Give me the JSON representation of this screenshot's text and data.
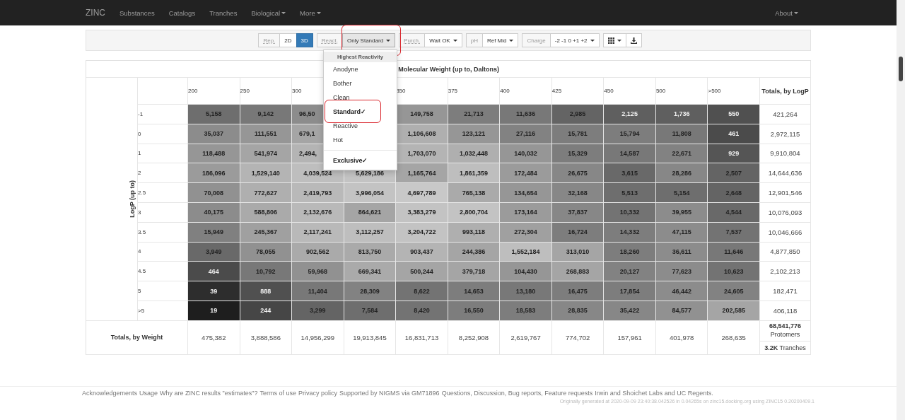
{
  "navbar": {
    "brand": "ZINC",
    "items": [
      {
        "label": "Substances",
        "dropdown": false
      },
      {
        "label": "Catalogs",
        "dropdown": false
      },
      {
        "label": "Tranches",
        "dropdown": false
      },
      {
        "label": "Biological",
        "dropdown": true
      },
      {
        "label": "More",
        "dropdown": true
      }
    ],
    "right_items": [
      {
        "label": "About",
        "dropdown": true
      }
    ]
  },
  "toolbar": {
    "groups": [
      {
        "items": [
          {
            "kind": "hint",
            "text": "Rep."
          },
          {
            "kind": "toggle",
            "text": "2D",
            "selected": false
          },
          {
            "kind": "toggle",
            "text": "3D",
            "selected": true
          }
        ]
      },
      {
        "items": [
          {
            "kind": "hint",
            "text": "React."
          },
          {
            "kind": "dropdown",
            "text": "Only Standard",
            "open": true,
            "highlighted": true,
            "menu": {
              "header": "Highest Reactivity",
              "items": [
                {
                  "label": "Anodyne",
                  "selected": false,
                  "highlighted": false
                },
                {
                  "label": "Bother",
                  "selected": false,
                  "highlighted": false
                },
                {
                  "label": "Clean",
                  "selected": false,
                  "highlighted": false
                },
                {
                  "label": "Standard✓",
                  "selected": true,
                  "highlighted": true
                },
                {
                  "label": "Reactive",
                  "selected": false,
                  "highlighted": false
                },
                {
                  "label": "Hot",
                  "selected": false,
                  "highlighted": false
                }
              ],
              "extra_items": [
                {
                  "label": "Exclusive✓",
                  "selected": true,
                  "highlighted": false
                }
              ]
            }
          }
        ]
      },
      {
        "items": [
          {
            "kind": "hint",
            "text": "Purch."
          },
          {
            "kind": "dropdown",
            "text": "Wait OK",
            "open": false,
            "highlighted": false
          }
        ]
      },
      {
        "items": [
          {
            "kind": "label",
            "text": "pH"
          },
          {
            "kind": "dropdown",
            "text": "Ref Mid",
            "open": false,
            "highlighted": false
          }
        ]
      },
      {
        "items": [
          {
            "kind": "label",
            "text": "Charge"
          },
          {
            "kind": "dropdown",
            "text": "-2 -1 0 +1 +2",
            "open": false,
            "highlighted": false
          }
        ]
      },
      {
        "items": [
          {
            "kind": "grid-menu"
          },
          {
            "kind": "download"
          }
        ]
      }
    ]
  },
  "table": {
    "title": "Molecular Weight (up to, Daltons)",
    "row_axis_label": "LogP (up to)",
    "columns": [
      "200",
      "250",
      "300",
      null,
      "350",
      "375",
      "400",
      "425",
      "450",
      "500",
      ">500"
    ],
    "totals_column_header": "Totals, by LogP",
    "rows": [
      {
        "logp": "-1",
        "cells": [
          {
            "value": "5,158",
            "color": "#6e6e6e"
          },
          {
            "value": "9,142",
            "color": "#787878"
          },
          {
            "value": "96,50",
            "color": "#8c8c8c"
          },
          null,
          {
            "value": "149,758",
            "color": "#969696"
          },
          {
            "value": "21,713",
            "color": "#7d7d7d"
          },
          {
            "value": "11,636",
            "color": "#787878"
          },
          {
            "value": "2,985",
            "color": "#646464"
          },
          {
            "value": "2,125",
            "color": "#5f5f5f"
          },
          {
            "value": "1,736",
            "color": "#5f5f5f"
          },
          {
            "value": "550",
            "color": "#505050"
          }
        ],
        "total": "421,264"
      },
      {
        "logp": "0",
        "cells": [
          {
            "value": "35,037",
            "color": "#8c8c8c"
          },
          {
            "value": "111,551",
            "color": "#969696"
          },
          {
            "value": "679,1",
            "color": "#a5a5a5"
          },
          null,
          {
            "value": "1,106,608",
            "color": "#afafaf"
          },
          {
            "value": "123,121",
            "color": "#969696"
          },
          {
            "value": "27,116",
            "color": "#828282"
          },
          {
            "value": "15,781",
            "color": "#7d7d7d"
          },
          {
            "value": "15,794",
            "color": "#7d7d7d"
          },
          {
            "value": "11,808",
            "color": "#787878"
          },
          {
            "value": "461",
            "color": "#4b4b4b"
          }
        ],
        "total": "2,972,115"
      },
      {
        "logp": "1",
        "cells": [
          {
            "value": "118,488",
            "color": "#969696"
          },
          {
            "value": "541,974",
            "color": "#a5a5a5"
          },
          {
            "value": "2,494,",
            "color": "#b4b4b4"
          },
          null,
          {
            "value": "1,703,070",
            "color": "#b4b4b4"
          },
          {
            "value": "1,032,448",
            "color": "#afafaf"
          },
          {
            "value": "140,032",
            "color": "#969696"
          },
          {
            "value": "15,329",
            "color": "#7d7d7d"
          },
          {
            "value": "14,587",
            "color": "#787878"
          },
          {
            "value": "22,671",
            "color": "#828282"
          },
          {
            "value": "929",
            "color": "#555555"
          }
        ],
        "total": "9,910,804"
      },
      {
        "logp": "2",
        "cells": [
          {
            "value": "186,096",
            "color": "#9b9b9b"
          },
          {
            "value": "1,529,140",
            "color": "#b4b4b4"
          },
          {
            "value": "4,039,524",
            "color": "#bebebe"
          },
          {
            "value": "5,629,186",
            "color": "#c3c3c3"
          },
          {
            "value": "1,165,764",
            "color": "#a5a5a5"
          },
          {
            "value": "1,861,359",
            "color": "#bebebe"
          },
          {
            "value": "172,484",
            "color": "#9b9b9b"
          },
          {
            "value": "26,675",
            "color": "#878787"
          },
          {
            "value": "3,615",
            "color": "#696969"
          },
          {
            "value": "28,286",
            "color": "#878787"
          },
          {
            "value": "2,507",
            "color": "#646464"
          }
        ],
        "total": "14,644,636"
      },
      {
        "logp": "2.5",
        "cells": [
          {
            "value": "70,008",
            "color": "#919191"
          },
          {
            "value": "772,627",
            "color": "#afafaf"
          },
          {
            "value": "2,419,793",
            "color": "#b9b9b9"
          },
          {
            "value": "3,996,054",
            "color": "#c3c3c3"
          },
          {
            "value": "4,697,789",
            "color": "#c8c8c8"
          },
          {
            "value": "765,138",
            "color": "#aaaaaa"
          },
          {
            "value": "134,654",
            "color": "#969696"
          },
          {
            "value": "32,168",
            "color": "#878787"
          },
          {
            "value": "5,513",
            "color": "#6e6e6e"
          },
          {
            "value": "5,154",
            "color": "#6e6e6e"
          },
          {
            "value": "2,648",
            "color": "#646464"
          }
        ],
        "total": "12,901,546"
      },
      {
        "logp": "3",
        "cells": [
          {
            "value": "40,175",
            "color": "#8c8c8c"
          },
          {
            "value": "588,806",
            "color": "#aaaaaa"
          },
          {
            "value": "2,132,676",
            "color": "#b9b9b9"
          },
          {
            "value": "864,621",
            "color": "#a5a5a5"
          },
          {
            "value": "3,383,279",
            "color": "#c3c3c3"
          },
          {
            "value": "2,800,704",
            "color": "#c3c3c3"
          },
          {
            "value": "173,164",
            "color": "#9b9b9b"
          },
          {
            "value": "37,837",
            "color": "#878787"
          },
          {
            "value": "10,332",
            "color": "#737373"
          },
          {
            "value": "39,955",
            "color": "#8c8c8c"
          },
          {
            "value": "4,544",
            "color": "#696969"
          }
        ],
        "total": "10,076,093"
      },
      {
        "logp": "3.5",
        "cells": [
          {
            "value": "15,949",
            "color": "#808080"
          },
          {
            "value": "245,367",
            "color": "#a0a0a0"
          },
          {
            "value": "2,117,241",
            "color": "#b9b9b9"
          },
          {
            "value": "3,112,257",
            "color": "#bebebe"
          },
          {
            "value": "3,204,722",
            "color": "#c3c3c3"
          },
          {
            "value": "993,118",
            "color": "#afafaf"
          },
          {
            "value": "272,304",
            "color": "#a0a0a0"
          },
          {
            "value": "16,724",
            "color": "#7d7d7d"
          },
          {
            "value": "14,332",
            "color": "#7d7d7d"
          },
          {
            "value": "47,115",
            "color": "#8c8c8c"
          },
          {
            "value": "7,537",
            "color": "#737373"
          }
        ],
        "total": "10,046,666"
      },
      {
        "logp": "4",
        "cells": [
          {
            "value": "3,949",
            "color": "#696969"
          },
          {
            "value": "78,055",
            "color": "#919191"
          },
          {
            "value": "902,562",
            "color": "#aaaaaa"
          },
          {
            "value": "813,750",
            "color": "#aaaaaa"
          },
          {
            "value": "903,437",
            "color": "#b4b4b4"
          },
          {
            "value": "244,386",
            "color": "#a5a5a5"
          },
          {
            "value": "1,552,184",
            "color": "#bebebe"
          },
          {
            "value": "313,010",
            "color": "#a5a5a5"
          },
          {
            "value": "18,260",
            "color": "#7d7d7d"
          },
          {
            "value": "36,611",
            "color": "#8c8c8c"
          },
          {
            "value": "11,646",
            "color": "#787878"
          }
        ],
        "total": "4,877,850"
      },
      {
        "logp": "4.5",
        "cells": [
          {
            "value": "464",
            "color": "#4b4b4b"
          },
          {
            "value": "10,792",
            "color": "#787878"
          },
          {
            "value": "59,968",
            "color": "#919191"
          },
          {
            "value": "669,341",
            "color": "#aaaaaa"
          },
          {
            "value": "500,244",
            "color": "#a5a5a5"
          },
          {
            "value": "379,718",
            "color": "#a5a5a5"
          },
          {
            "value": "104,430",
            "color": "#969696"
          },
          {
            "value": "268,883",
            "color": "#a5a5a5"
          },
          {
            "value": "20,127",
            "color": "#828282"
          },
          {
            "value": "77,623",
            "color": "#8c8c8c"
          },
          {
            "value": "10,623",
            "color": "#737373"
          }
        ],
        "total": "2,102,213"
      },
      {
        "logp": "5",
        "cells": [
          {
            "value": "39",
            "color": "#2d2d2d"
          },
          {
            "value": "888",
            "color": "#505050"
          },
          {
            "value": "11,404",
            "color": "#787878"
          },
          {
            "value": "28,309",
            "color": "#828282"
          },
          {
            "value": "8,622",
            "color": "#737373"
          },
          {
            "value": "14,653",
            "color": "#7d7d7d"
          },
          {
            "value": "13,180",
            "color": "#787878"
          },
          {
            "value": "16,475",
            "color": "#7d7d7d"
          },
          {
            "value": "17,854",
            "color": "#7d7d7d"
          },
          {
            "value": "46,442",
            "color": "#8c8c8c"
          },
          {
            "value": "24,605",
            "color": "#828282"
          }
        ],
        "total": "182,471"
      },
      {
        "logp": ">5",
        "cells": [
          {
            "value": "19",
            "color": "#1e1e1e"
          },
          {
            "value": "244",
            "color": "#464646"
          },
          {
            "value": "3,299",
            "color": "#646464"
          },
          {
            "value": "7,584",
            "color": "#6e6e6e"
          },
          {
            "value": "8,420",
            "color": "#737373"
          },
          {
            "value": "16,550",
            "color": "#7d7d7d"
          },
          {
            "value": "18,583",
            "color": "#7d7d7d"
          },
          {
            "value": "28,835",
            "color": "#878787"
          },
          {
            "value": "35,422",
            "color": "#878787"
          },
          {
            "value": "84,577",
            "color": "#919191"
          },
          {
            "value": "202,585",
            "color": "#a5a5a5"
          }
        ],
        "total": "406,118"
      }
    ],
    "totals_row_label": "Totals, by Weight",
    "column_totals": [
      "475,382",
      "3,888,586",
      "14,956,299",
      "19,913,845",
      "16,831,713",
      "8,252,908",
      "2,619,767",
      "774,702",
      "157,961",
      "401,978",
      "268,635"
    ],
    "grand_total": "**68,541,776** Protomers",
    "tranches": "**3.2K** Tranches"
  },
  "footer": {
    "links": [
      "Acknowledgements",
      "Usage",
      "Why are ZINC results \"estimates\"?",
      "Terms of use",
      "Privacy policy",
      "Supported by NIGMS via GM71896",
      "Questions, Discussion, Bug reports, Feature requests",
      "Irwin and Shoichet Labs and UC Regents."
    ],
    "generated": "Originally generated at 2020-09-09 23:40:38.042526 in 0.04265s on zinc15.docking.org using ZINC15 0.20200409.1"
  }
}
